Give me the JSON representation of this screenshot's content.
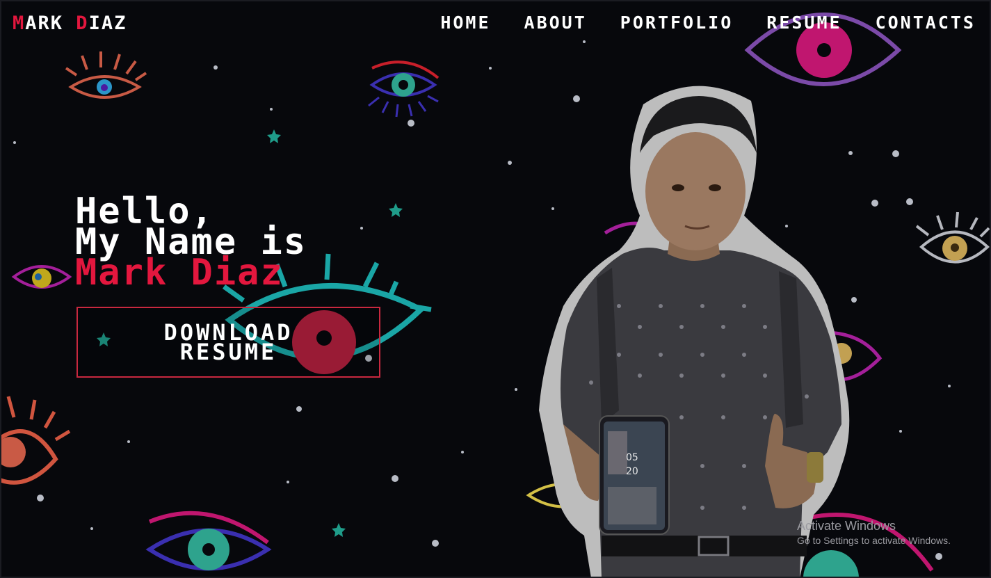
{
  "brand": {
    "first_initial": "M",
    "first_rest": "ARK ",
    "last_initial": "D",
    "last_rest": "IAZ",
    "accent": "#e3173e"
  },
  "nav": {
    "items": [
      {
        "label": "HOME"
      },
      {
        "label": "ABOUT"
      },
      {
        "label": "PORTFOLIO"
      },
      {
        "label": "RESUME"
      },
      {
        "label": "CONTACTS"
      }
    ]
  },
  "hero": {
    "line1": "Hello,",
    "line2": "My Name is",
    "name": "Mark Diaz",
    "button_line1": "DOWNLOAD",
    "button_line2": "RESUME"
  },
  "phone": {
    "time_hours": "05",
    "time_minutes": "20"
  },
  "watermark": {
    "title": "Activate Windows",
    "subtitle": "Go to Settings to activate Windows."
  }
}
